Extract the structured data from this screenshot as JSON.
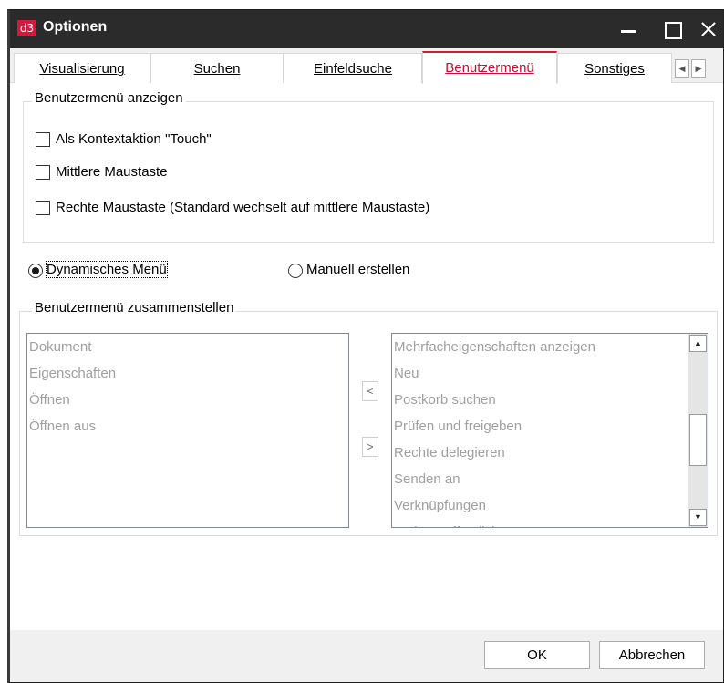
{
  "window": {
    "logo": "d3",
    "title": "Optionen"
  },
  "tabs": [
    {
      "label": "Visualisierung"
    },
    {
      "label": "Suchen"
    },
    {
      "label": "Einfeldsuche"
    },
    {
      "label": "Benutzermenü"
    },
    {
      "label": "Sonstiges"
    }
  ],
  "tab_scroll": {
    "left": "◀",
    "right": "▶"
  },
  "group_show": {
    "legend": "Benutzermenü anzeigen",
    "options": [
      {
        "label": "Als Kontextaktion \"Touch\"",
        "checked": false
      },
      {
        "label": "Mittlere Maustaste",
        "checked": false
      },
      {
        "label": "Rechte Maustaste (Standard wechselt auf mittlere Maustaste)",
        "checked": false
      }
    ]
  },
  "mode": {
    "dynamic_label": "Dynamisches Menü",
    "manual_label": "Manuell erstellen",
    "selected": "dynamic"
  },
  "group_compose": {
    "legend": "Benutzermenü zusammenstellen",
    "left_items": [
      "Dokument",
      "Eigenschaften",
      "Öffnen",
      "Öffnen aus"
    ],
    "right_items": [
      "Mehrfacheigenschaften anzeigen",
      "Neu",
      "Postkorb suchen",
      "Prüfen und freigeben",
      "Rechte delegieren",
      "Senden an",
      "Verknüpfungen",
      "Web veröffentlicht"
    ],
    "move_left": "<",
    "move_right": ">"
  },
  "buttons": {
    "ok": "OK",
    "cancel": "Abbrechen"
  },
  "colors": {
    "accent": "#d4193a",
    "titlebar": "#2b2b2b",
    "disabled_text": "#a0a0a0"
  }
}
